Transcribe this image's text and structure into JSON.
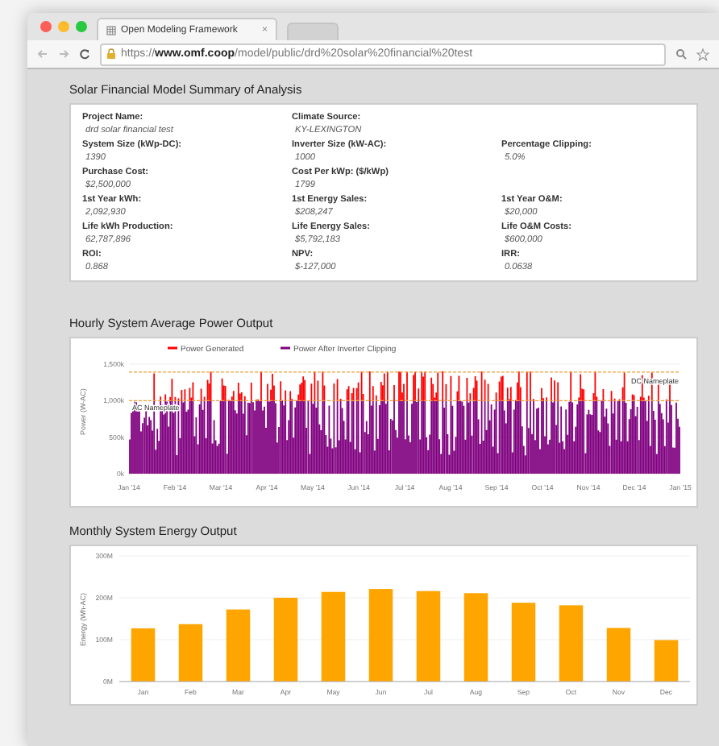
{
  "browser": {
    "tab": {
      "title": "Open Modeling Framework",
      "close": "×"
    },
    "url": {
      "scheme": "https://",
      "host": "www.omf.coop",
      "path": "/model/public/drd%20solar%20financial%20test"
    }
  },
  "summary": {
    "title": "Solar Financial Model Summary of Analysis",
    "rows": [
      [
        {
          "label": "Project Name:",
          "value": "drd solar financial test"
        },
        {
          "label": "Climate Source:",
          "value": "KY-LEXINGTON"
        }
      ],
      [
        {
          "label": "System Size (kWp-DC):",
          "value": "1390"
        },
        {
          "label": "Inverter Size (kW-AC):",
          "value": "1000"
        },
        {
          "label": "Percentage Clipping:",
          "value": "5.0%"
        }
      ],
      [
        {
          "label": "Purchase Cost:",
          "value": "$2,500,000"
        },
        {
          "label": "Cost Per kWp: ($/kWp)",
          "value": "1799"
        }
      ],
      [
        {
          "label": "1st Year kWh:",
          "value": "2,092,930"
        },
        {
          "label": "1st Energy Sales:",
          "value": "$208,247"
        },
        {
          "label": "1st Year O&M:",
          "value": "$20,000"
        }
      ],
      [
        {
          "label": "Life kWh Production:",
          "value": "62,787,896"
        },
        {
          "label": "Life Energy Sales:",
          "value": "$5,792,183"
        },
        {
          "label": "Life O&M Costs:",
          "value": "$600,000"
        }
      ],
      [
        {
          "label": "ROI:",
          "value": "0.868"
        },
        {
          "label": "NPV:",
          "value": "$-127,000"
        },
        {
          "label": "IRR:",
          "value": "0.0638"
        }
      ]
    ]
  },
  "hourly": {
    "title": "Hourly System Average Power Output",
    "legend": [
      {
        "name": "Power Generated",
        "color": "#ff0000"
      },
      {
        "name": "Power After Inverter Clipping",
        "color": "#800080"
      }
    ],
    "ylabel": "Power (W-AC)",
    "yticks": [
      "1,500k",
      "1,000k",
      "500k",
      "0k"
    ],
    "xticks": [
      "Jan '14",
      "Feb '14",
      "Mar '14",
      "Apr '14",
      "May '14",
      "Jun '14",
      "Jul '14",
      "Aug '14",
      "Sep '14",
      "Oct '14",
      "Nov '14",
      "Dec '14",
      "Jan '15"
    ],
    "lines": [
      {
        "label": "DC Nameplate"
      },
      {
        "label": "AC Nameplate"
      }
    ]
  },
  "monthly": {
    "title": "Monthly System Energy Output",
    "chart_data": {
      "type": "bar",
      "ylabel": "Energy (Wh-AC)",
      "categories": [
        "Jan",
        "Feb",
        "Mar",
        "Apr",
        "May",
        "Jun",
        "Jul",
        "Aug",
        "Sep",
        "Oct",
        "Nov",
        "Dec"
      ],
      "series": [
        {
          "color": "#ffa500",
          "values": [
            127,
            137,
            172,
            200,
            214,
            221,
            216,
            211,
            188,
            182,
            128,
            99
          ]
        }
      ],
      "ylim": [
        0,
        300
      ],
      "yticks": [
        {
          "value": 0,
          "label": "0M"
        },
        {
          "value": 100,
          "label": "100M"
        },
        {
          "value": 200,
          "label": "200M"
        },
        {
          "value": 300,
          "label": "300M"
        }
      ]
    }
  }
}
